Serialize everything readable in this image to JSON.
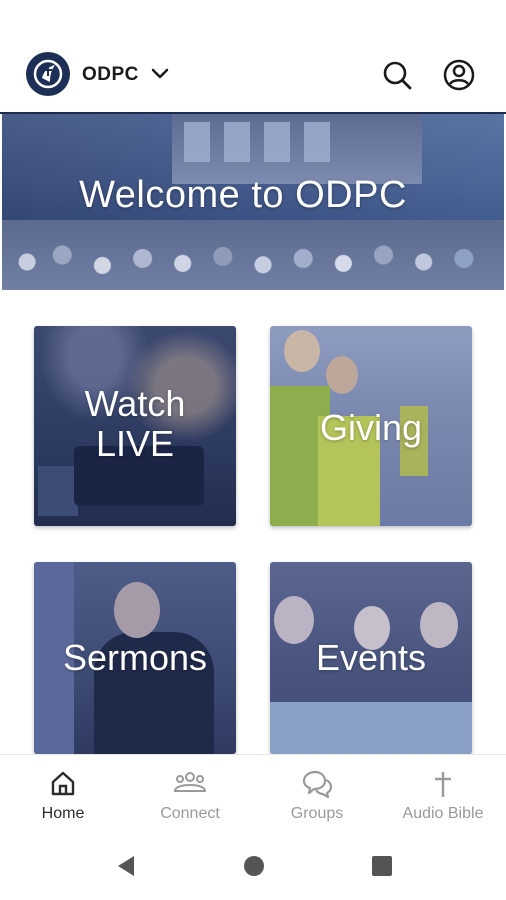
{
  "header": {
    "church_name": "ODPC",
    "logo_icon": "church-logo-icon",
    "search_icon": "search-icon",
    "account_icon": "account-circle-icon"
  },
  "hero": {
    "title": "Welcome to ODPC"
  },
  "tiles": [
    {
      "label": "Watch\nLIVE"
    },
    {
      "label": "Giving"
    },
    {
      "label": "Sermons"
    },
    {
      "label": "Events"
    }
  ],
  "bottom_nav": {
    "items": [
      {
        "label": "Home",
        "icon": "home-icon",
        "active": true
      },
      {
        "label": "Connect",
        "icon": "people-icon",
        "active": false
      },
      {
        "label": "Groups",
        "icon": "chat-bubbles-icon",
        "active": false
      },
      {
        "label": "Audio Bible",
        "icon": "cross-icon",
        "active": false
      }
    ]
  },
  "system_nav": {
    "back": "back-icon",
    "home": "home-circle-icon",
    "recents": "recents-square-icon"
  },
  "colors": {
    "brand_navy": "#1d2f57",
    "tile_overlay": "#2b3d70",
    "nav_active": "#2b2b2b",
    "nav_inactive": "#9a9a9a"
  }
}
